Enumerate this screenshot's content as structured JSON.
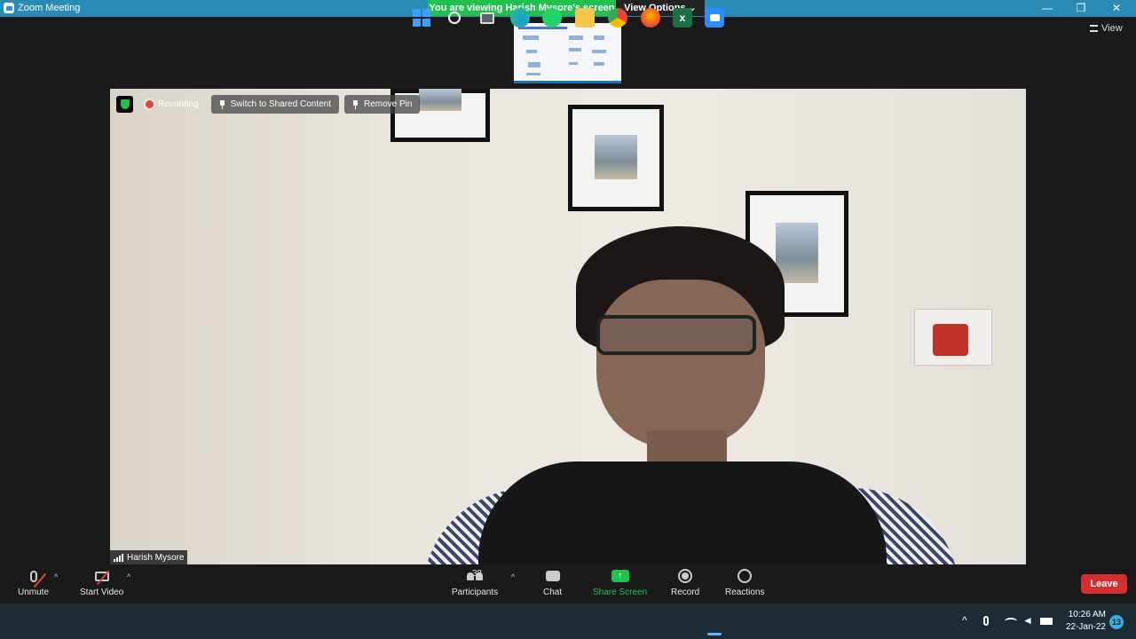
{
  "window": {
    "title": "Zoom Meeting"
  },
  "banner": {
    "viewing": "You are viewing Harish Mysore's screen",
    "view_options": "View Options"
  },
  "controls": {
    "minimize": "—",
    "maximize": "❐",
    "close": "✕"
  },
  "view_button": "View",
  "overlay": {
    "recording": "Recording",
    "switch_label": "Switch to Shared Content",
    "remove_pin_label": "Remove Pin"
  },
  "participant": {
    "name": "Harish Mysore"
  },
  "toolbar": {
    "unmute": "Unmute",
    "start_video": "Start Video",
    "participants": "Participants",
    "participants_count": "38",
    "chat": "Chat",
    "share_screen": "Share Screen",
    "record": "Record",
    "reactions": "Reactions",
    "leave": "Leave"
  },
  "colors": {
    "share_green": "#20c150",
    "leave_red": "#d32f2f",
    "titlebar_blue": "#2a8bb4",
    "taskbar": "#1d2b35"
  },
  "taskbar": {
    "icons": [
      "windows-start-icon",
      "search-icon",
      "task-view-icon",
      "edge-icon",
      "whatsapp-icon",
      "file-explorer-icon",
      "chrome-icon",
      "firefox-icon",
      "excel-icon",
      "zoom-icon"
    ],
    "time": "10:26 AM",
    "date": "22-Jan-22",
    "notifications": "13"
  }
}
